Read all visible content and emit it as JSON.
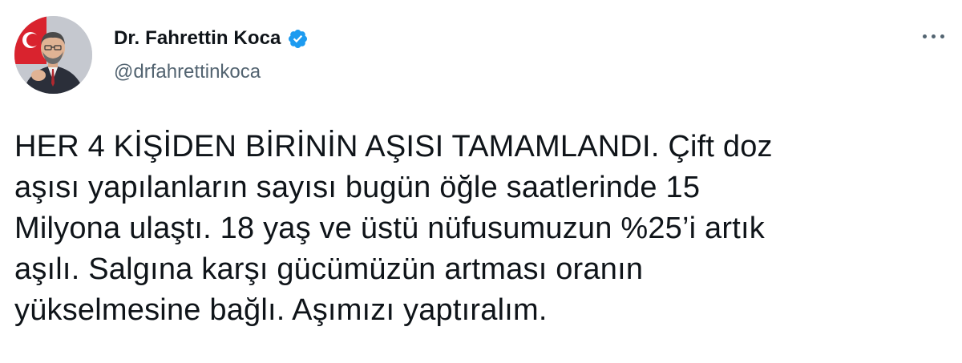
{
  "author": {
    "display_name": "Dr. Fahrettin Koca",
    "handle": "@drfahrettinkoca",
    "verified_icon": "verified-badge-icon",
    "avatar_icon": "profile-photo"
  },
  "menu_icon": "more-options-icon",
  "tweet": {
    "text": "HER 4 KİŞİDEN BİRİNİN AŞISI TAMAMLANDI. Çift doz\naşısı yapılanların sayısı bugün öğle saatlerinde 15\nMilyona ulaştı. 18 yaş ve üstü nüfusumuzun %25’i artık\naşılı. Salgına karşı gücümüzün artması oranın\nyükselmesine bağlı. Aşımızı yaptıralım."
  },
  "colors": {
    "text_primary": "#0f1419",
    "text_secondary": "#536471",
    "verified_blue": "#1d9bf0",
    "flag_red": "#d9232e"
  }
}
